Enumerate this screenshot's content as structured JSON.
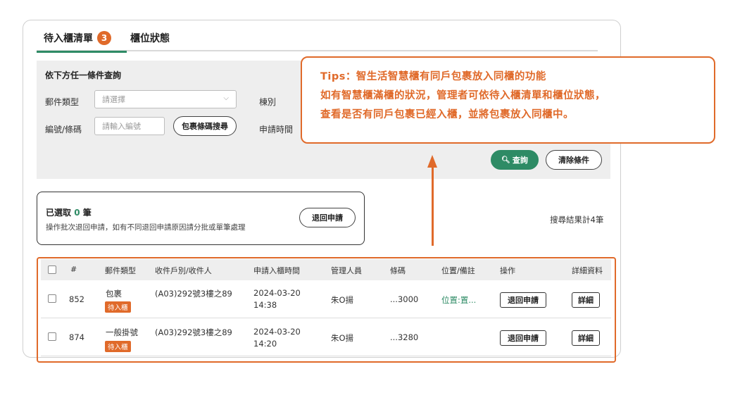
{
  "tabs": {
    "pending_label": "待入櫃清單",
    "pending_count": "3",
    "status_label": "櫃位狀態"
  },
  "filter": {
    "title": "依下方任一條件查詢",
    "mail_type_label": "郵件類型",
    "mail_type_placeholder": "請選擇",
    "building_label": "棟別",
    "code_label": "編號/條碼",
    "code_placeholder": "請輸入編號",
    "barcode_search_label": "包裹條碼搜尋",
    "apply_time_label": "申請時間",
    "query_label": "查詢",
    "clear_label": "清除條件"
  },
  "tip": {
    "line1": "Tips：智生活智慧櫃有同戶包裹放入同櫃的功能",
    "line2": "如有智慧櫃滿櫃的狀況，管理者可依待入櫃清單和櫃位狀態，",
    "line3": "查看是否有同戶包裹已經入櫃，並將包裹放入同櫃中。"
  },
  "selection": {
    "prefix": "已選取",
    "count": "0",
    "suffix": "筆",
    "description": "操作批次退回申請，如有不同退回申請原因請分批或單筆處理",
    "return_label": "退回申請"
  },
  "result_count": "搜尋結果計4筆",
  "table": {
    "headers": [
      "#",
      "郵件類型",
      "收件戶別/收件人",
      "申請入櫃時間",
      "管理人員",
      "條碼",
      "位置/備註",
      "操作",
      "詳細資料"
    ],
    "rows": [
      {
        "id": "852",
        "type": "包裹",
        "status_tag": "待入櫃",
        "recipient": "(A03)292號3樓之89",
        "date": "2024-03-20",
        "time": "14:38",
        "manager": "朱O揚",
        "barcode": "...3000",
        "location": "位置:置...",
        "action": "退回申請",
        "detail": "詳細"
      },
      {
        "id": "874",
        "type": "一般掛號",
        "status_tag": "待入櫃",
        "recipient": "(A03)292號3樓之89",
        "date": "2024-03-20",
        "time": "14:20",
        "manager": "朱O揚",
        "barcode": "...3280",
        "location": "",
        "action": "退回申請",
        "detail": "詳細"
      }
    ]
  },
  "colors": {
    "accent": "#e06a2a",
    "brand_green": "#2e8b65"
  },
  "icons": {
    "search": "search-icon",
    "dropdown": "chevron-down-icon"
  }
}
